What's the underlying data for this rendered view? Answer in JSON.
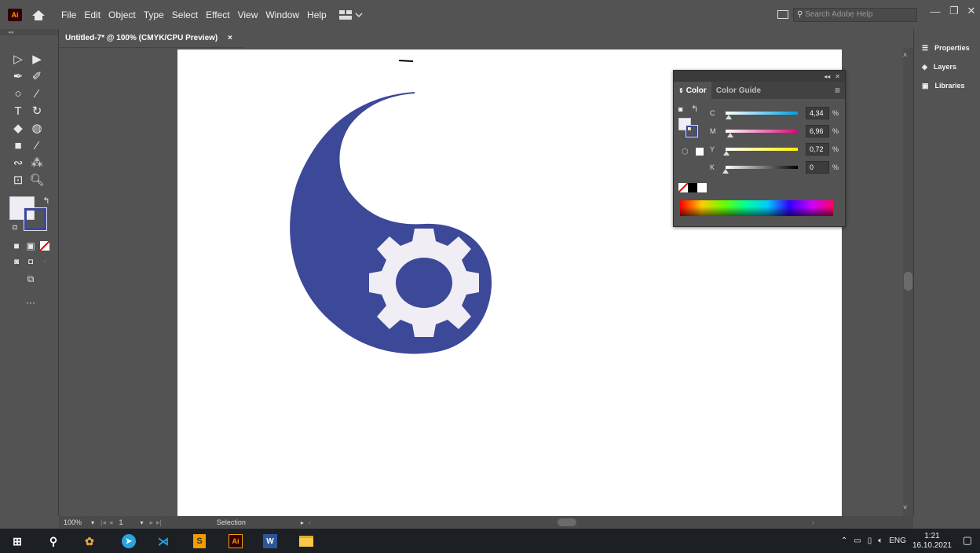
{
  "menubar": {
    "logo": "Ai",
    "items": [
      "File",
      "Edit",
      "Object",
      "Type",
      "Select",
      "Effect",
      "View",
      "Window",
      "Help"
    ],
    "search_placeholder": "Search Adobe Help"
  },
  "document": {
    "tab_title": "Untitled-7* @ 100% (CMYK/CPU Preview)",
    "close_glyph": "×"
  },
  "right_panel": {
    "items": [
      {
        "label": "Properties",
        "icon": "properties-icon"
      },
      {
        "label": "Layers",
        "icon": "layers-icon"
      },
      {
        "label": "Libraries",
        "icon": "libraries-icon"
      }
    ]
  },
  "color_panel": {
    "tabs": [
      "Color",
      "Color Guide"
    ],
    "sliders": [
      {
        "label": "C",
        "value": "4,34",
        "unit": "%",
        "level": 0.0434,
        "gradient": [
          "#ffffff",
          "#00a0e3"
        ]
      },
      {
        "label": "M",
        "value": "6,96",
        "unit": "%",
        "level": 0.0696,
        "gradient": [
          "#ffffff",
          "#e2007a"
        ]
      },
      {
        "label": "Y",
        "value": "0,72",
        "unit": "%",
        "level": 0.0072,
        "gradient": [
          "#ffffff",
          "#ffed00"
        ]
      },
      {
        "label": "K",
        "value": "0",
        "unit": "%",
        "level": 0.0,
        "gradient": [
          "#ffffff",
          "#000000"
        ]
      }
    ]
  },
  "status": {
    "zoom": "100%",
    "page": "1",
    "tool": "Selection"
  },
  "artwork": {
    "fill_color": "#3c4898",
    "gear_color": "#f1edf5"
  },
  "taskbar": {
    "lang": "ENG",
    "time": "1:21",
    "date": "16.10.2021"
  }
}
